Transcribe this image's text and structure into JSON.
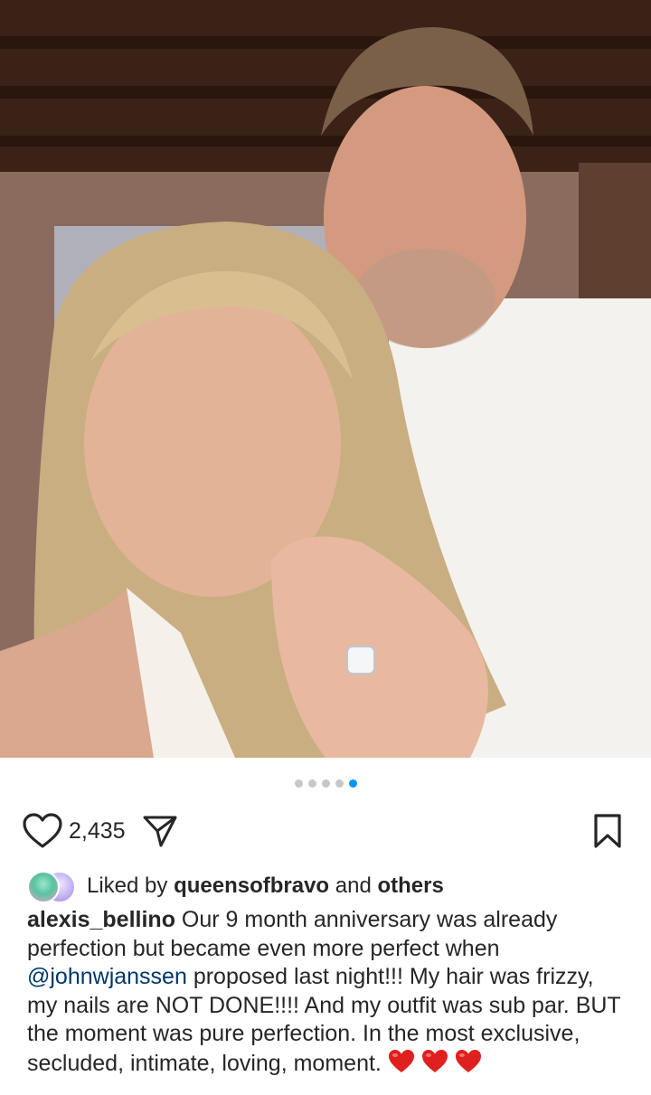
{
  "post": {
    "carousel": {
      "total": 5,
      "active_index": 4
    },
    "likes_count": "2,435",
    "liked_by": {
      "prefix": "Liked by",
      "user": "queensofbravo",
      "joiner": "and",
      "suffix": "others"
    },
    "caption": {
      "username": "alexis_bellino",
      "text_part1": "Our 9 month anniversary was already perfection but became even more perfect when",
      "mention": "@johnwjanssen",
      "text_part2": "proposed last night!!! My hair was frizzy, my nails are NOT DONE!!!! And my outfit was sub par. BUT the moment was pure perfection. In the most exclusive, secluded, intimate, loving, moment."
    },
    "emoji": "red-heart",
    "emoji_count": 3
  },
  "icons": {
    "like": "heart-outline-icon",
    "share": "paper-plane-icon",
    "save": "bookmark-outline-icon"
  },
  "colors": {
    "accent_dot": "#0095f6",
    "mention": "#00376b",
    "heart_emoji": "#e0201e"
  }
}
